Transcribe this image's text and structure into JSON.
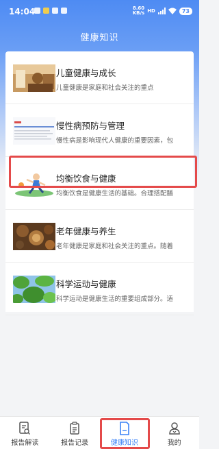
{
  "status_bar": {
    "time": "14:04",
    "net_speed_value": "8.60",
    "net_speed_unit": "KB/s",
    "network_type": "HD",
    "battery": "73"
  },
  "header": {
    "title": "健康知识"
  },
  "articles": [
    {
      "title": "儿童健康与成长",
      "desc": "儿童健康是家庭和社会关注的重点",
      "thumb": "child-photo"
    },
    {
      "title": "慢性病预防与管理",
      "desc": "慢性病是影响现代人健康的重要因素，包",
      "thumb": "document-screenshot"
    },
    {
      "title": "均衡饮食与健康",
      "desc": "均衡饮食是健康生活的基础。合理搭配膳",
      "thumb": "cartoon-runner"
    },
    {
      "title": "老年健康与养生",
      "desc": "老年健康是家庭和社会关注的重点。随着",
      "thumb": "herbs-photo"
    },
    {
      "title": "科学运动与健康",
      "desc": "科学运动是健康生活的重要组成部分。适",
      "thumb": "leaves-photo"
    }
  ],
  "bottom_nav": [
    {
      "label": "报告解读",
      "icon": "report-read-icon",
      "active": false
    },
    {
      "label": "报告记录",
      "icon": "clipboard-icon",
      "active": false
    },
    {
      "label": "健康知识",
      "icon": "document-icon",
      "active": true
    },
    {
      "label": "我的",
      "icon": "user-icon",
      "active": false
    }
  ],
  "colors": {
    "primary": "#4e8bf3",
    "active": "#3b82f6",
    "highlight": "#e44a4a"
  }
}
